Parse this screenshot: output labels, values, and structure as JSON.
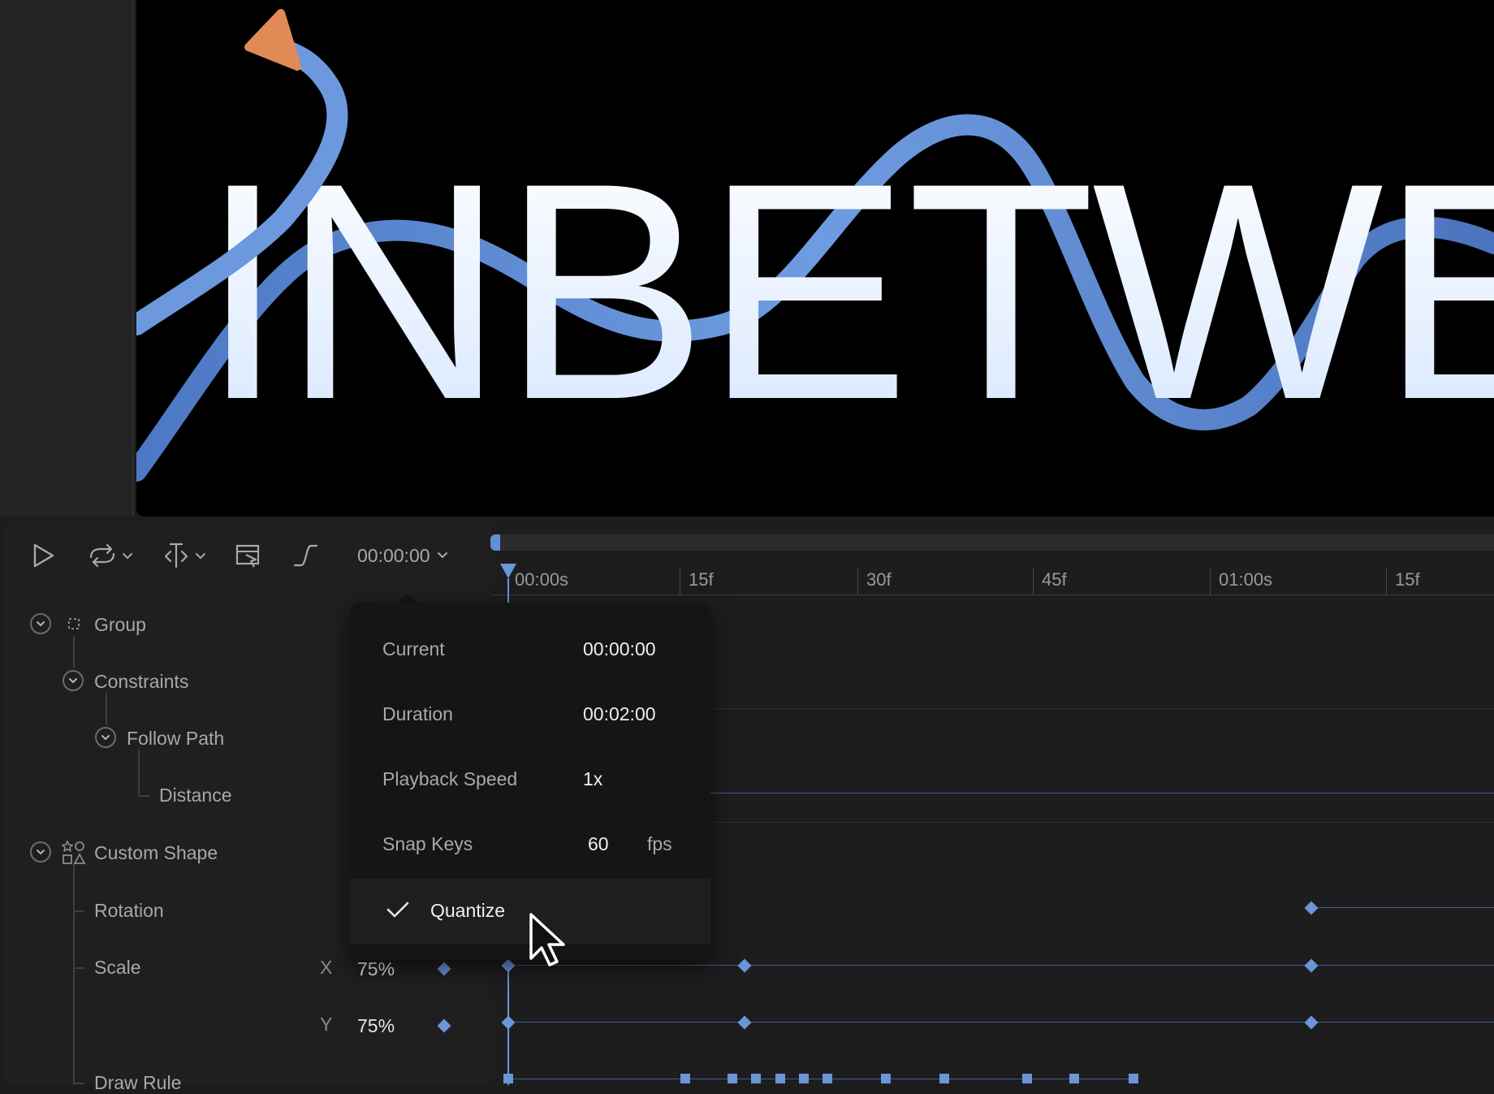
{
  "canvas": {
    "headline": "INBETWE",
    "colors": {
      "text_top": "#ffffff",
      "text_bottom": "#d9e8ff",
      "path": "#5b86cf",
      "arrow": "#e08a55"
    }
  },
  "toolbar": {
    "time": "00:00:00",
    "icons": [
      "play-icon",
      "loop-icon",
      "split-icon",
      "export-frame-icon",
      "easing-icon"
    ]
  },
  "ruler": {
    "ticks": [
      "00:00s",
      "15f",
      "30f",
      "45f",
      "01:00s",
      "15f"
    ]
  },
  "layers": {
    "group": "Group",
    "constraints": "Constraints",
    "follow_path": "Follow Path",
    "distance": "Distance",
    "custom_shape": "Custom Shape",
    "rotation": "Rotation",
    "scale": "Scale",
    "draw_rule": "Draw Rule",
    "scale_x_label": "X",
    "scale_x_value": "75%",
    "scale_y_label": "Y",
    "scale_y_value": "75%"
  },
  "popup": {
    "current_label": "Current",
    "current_value": "00:00:00",
    "duration_label": "Duration",
    "duration_value": "00:02:00",
    "speed_label": "Playback Speed",
    "speed_value": "1x",
    "snap_label": "Snap Keys",
    "snap_value": "60",
    "snap_unit": "fps",
    "quantize_label": "Quantize",
    "quantize_checked": true
  },
  "accent": "#6b95d6"
}
